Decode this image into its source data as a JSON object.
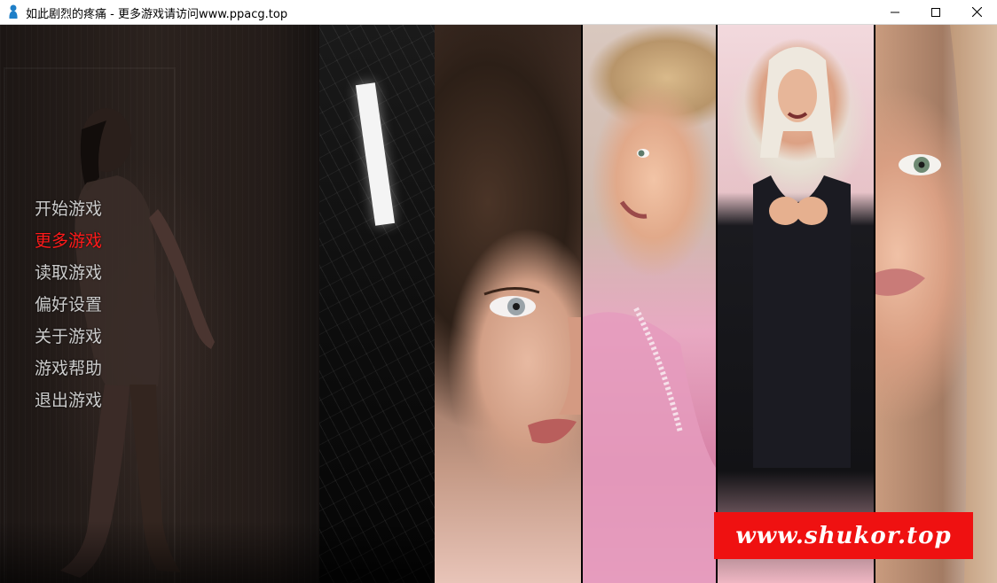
{
  "window": {
    "title": "如此剧烈的疼痛 - 更多游戏请访问www.ppacg.top",
    "controls": {
      "minimize": "minimize",
      "maximize": "maximize",
      "close": "close"
    }
  },
  "menu": {
    "items": [
      {
        "label": "开始游戏",
        "active": false
      },
      {
        "label": "更多游戏",
        "active": true
      },
      {
        "label": "读取游戏",
        "active": false
      },
      {
        "label": "偏好设置",
        "active": false
      },
      {
        "label": "关于游戏",
        "active": false
      },
      {
        "label": "游戏帮助",
        "active": false
      },
      {
        "label": "退出游戏",
        "active": false
      }
    ]
  },
  "watermark": {
    "text": "www.shukor.top"
  },
  "colors": {
    "menu_text": "#cbcbcb",
    "menu_active": "#ff1a1a",
    "watermark_bg": "#ef1111"
  }
}
